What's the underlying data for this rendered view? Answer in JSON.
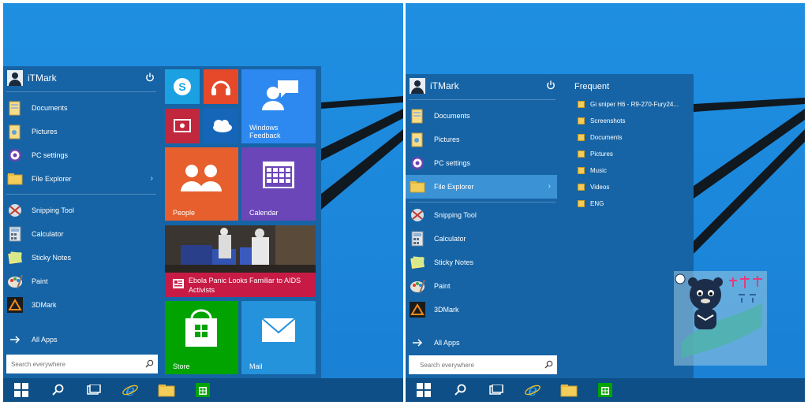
{
  "left_screen": {
    "user": {
      "name": "iTMark"
    },
    "menu_items": [
      {
        "label": "Documents",
        "icon": "documents-icon"
      },
      {
        "label": "Pictures",
        "icon": "pictures-icon"
      },
      {
        "label": "PC settings",
        "icon": "gear-icon"
      },
      {
        "label": "File Explorer",
        "icon": "folder-icon",
        "chevron": "›"
      },
      {
        "label": "Snipping Tool",
        "icon": "snipping-tool-icon"
      },
      {
        "label": "Calculator",
        "icon": "calculator-icon"
      },
      {
        "label": "Sticky Notes",
        "icon": "sticky-notes-icon"
      },
      {
        "label": "Paint",
        "icon": "paint-icon"
      },
      {
        "label": "3DMark",
        "icon": "3dmark-icon"
      }
    ],
    "all_apps": "All Apps",
    "search_placeholder": "Search everywhere",
    "tiles": {
      "windows_feedback": "Windows Feedback",
      "people": "People",
      "calendar": "Calendar",
      "news_headline": "Ebola Panic Looks Familiar to AIDS Activists",
      "store": "Store",
      "mail": "Mail"
    }
  },
  "right_screen": {
    "user": {
      "name": "iTMark"
    },
    "frequent_title": "Frequent",
    "menu_items": [
      {
        "label": "Documents",
        "icon": "documents-icon"
      },
      {
        "label": "Pictures",
        "icon": "pictures-icon"
      },
      {
        "label": "PC settings",
        "icon": "gear-icon"
      },
      {
        "label": "File Explorer",
        "icon": "folder-icon",
        "chevron": "›"
      },
      {
        "label": "Snipping Tool",
        "icon": "snipping-tool-icon"
      },
      {
        "label": "Calculator",
        "icon": "calculator-icon"
      },
      {
        "label": "Sticky Notes",
        "icon": "sticky-notes-icon"
      },
      {
        "label": "Paint",
        "icon": "paint-icon"
      },
      {
        "label": "3DMark",
        "icon": "3dmark-icon"
      }
    ],
    "frequent_items": [
      "Gi sniper H6 - R9-270-Fury24...",
      "Screenshots",
      "Documents",
      "Pictures",
      "Music",
      "Videos",
      "ENG"
    ],
    "all_apps": "All Apps",
    "search_placeholder": "Search everywhere"
  },
  "colors": {
    "desktop": "#1f8fe2",
    "start_menu": "#1664a6",
    "taskbar": "#0d4f86",
    "tile_skype": "#1ba1e2",
    "tile_music": "#e5492a",
    "tile_video": "#c1273d",
    "tile_onedrive": "#1566b9",
    "tile_feedback": "#2d89ef",
    "tile_people": "#e65f2c",
    "tile_calendar": "#6b46b8",
    "tile_news": "#c71b45",
    "tile_store": "#00a300",
    "tile_mail": "#2592dc"
  }
}
